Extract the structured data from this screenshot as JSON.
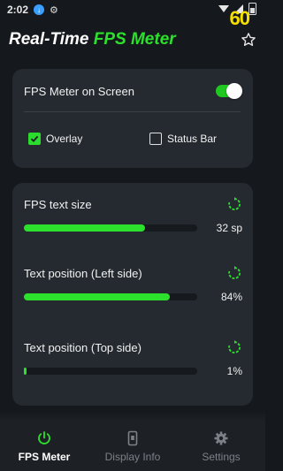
{
  "status_bar": {
    "time": "2:02",
    "download_icon": "download-icon",
    "settings_icon": "gear-icon",
    "fps_value": "60"
  },
  "header": {
    "title_part1": "Real-Time",
    "title_part2": "FPS Meter",
    "star_icon": "star-outline-icon"
  },
  "screen_card": {
    "toggle_label": "FPS Meter on Screen",
    "toggle_on": true,
    "options": [
      {
        "label": "Overlay",
        "checked": true
      },
      {
        "label": "Status Bar",
        "checked": false
      }
    ]
  },
  "settings": [
    {
      "label": "FPS text size",
      "value_text": "32 sp",
      "fill_fraction": 0.7
    },
    {
      "label": "Text position (Left side)",
      "value_text": "84%",
      "fill_fraction": 0.84
    },
    {
      "label": "Text position (Top side)",
      "value_text": "1%",
      "fill_fraction": 0.01
    }
  ],
  "bottom_nav": [
    {
      "label": "FPS Meter",
      "icon": "power-icon",
      "active": true
    },
    {
      "label": "Display Info",
      "icon": "phone-info-icon",
      "active": false
    },
    {
      "label": "Settings",
      "icon": "gear-icon",
      "active": false
    }
  ],
  "colors": {
    "accent": "#2ce12c",
    "background": "#15181c",
    "card": "#252a31",
    "fps_overlay": "#f5e000"
  }
}
